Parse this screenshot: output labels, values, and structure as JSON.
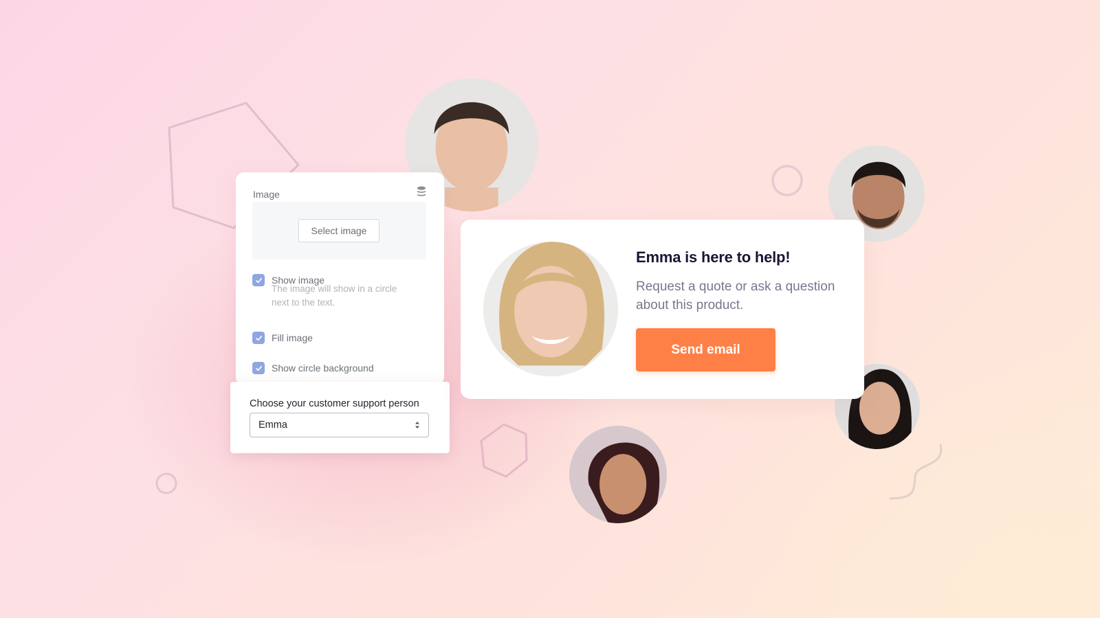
{
  "settings": {
    "image_label": "Image",
    "select_image_button": "Select image",
    "checkboxes": [
      {
        "label": "Show image",
        "checked": true
      },
      {
        "label": "Fill image",
        "checked": true
      },
      {
        "label": "Show circle background",
        "checked": true
      }
    ],
    "show_image_help": "The image will show in a circle next to the text."
  },
  "chooser": {
    "label": "Choose your customer support person",
    "selected": "Emma"
  },
  "widget": {
    "title": "Emma is here to help!",
    "description": "Request a quote or ask a question about this product.",
    "button_label": "Send email"
  },
  "colors": {
    "accent": "#ff8046",
    "checkbox": "#8fa6e0",
    "title": "#1e1335"
  },
  "avatars": [
    "man-short-hair",
    "man-beard",
    "woman-blonde",
    "woman-curly-hair",
    "woman-dark-hair"
  ]
}
